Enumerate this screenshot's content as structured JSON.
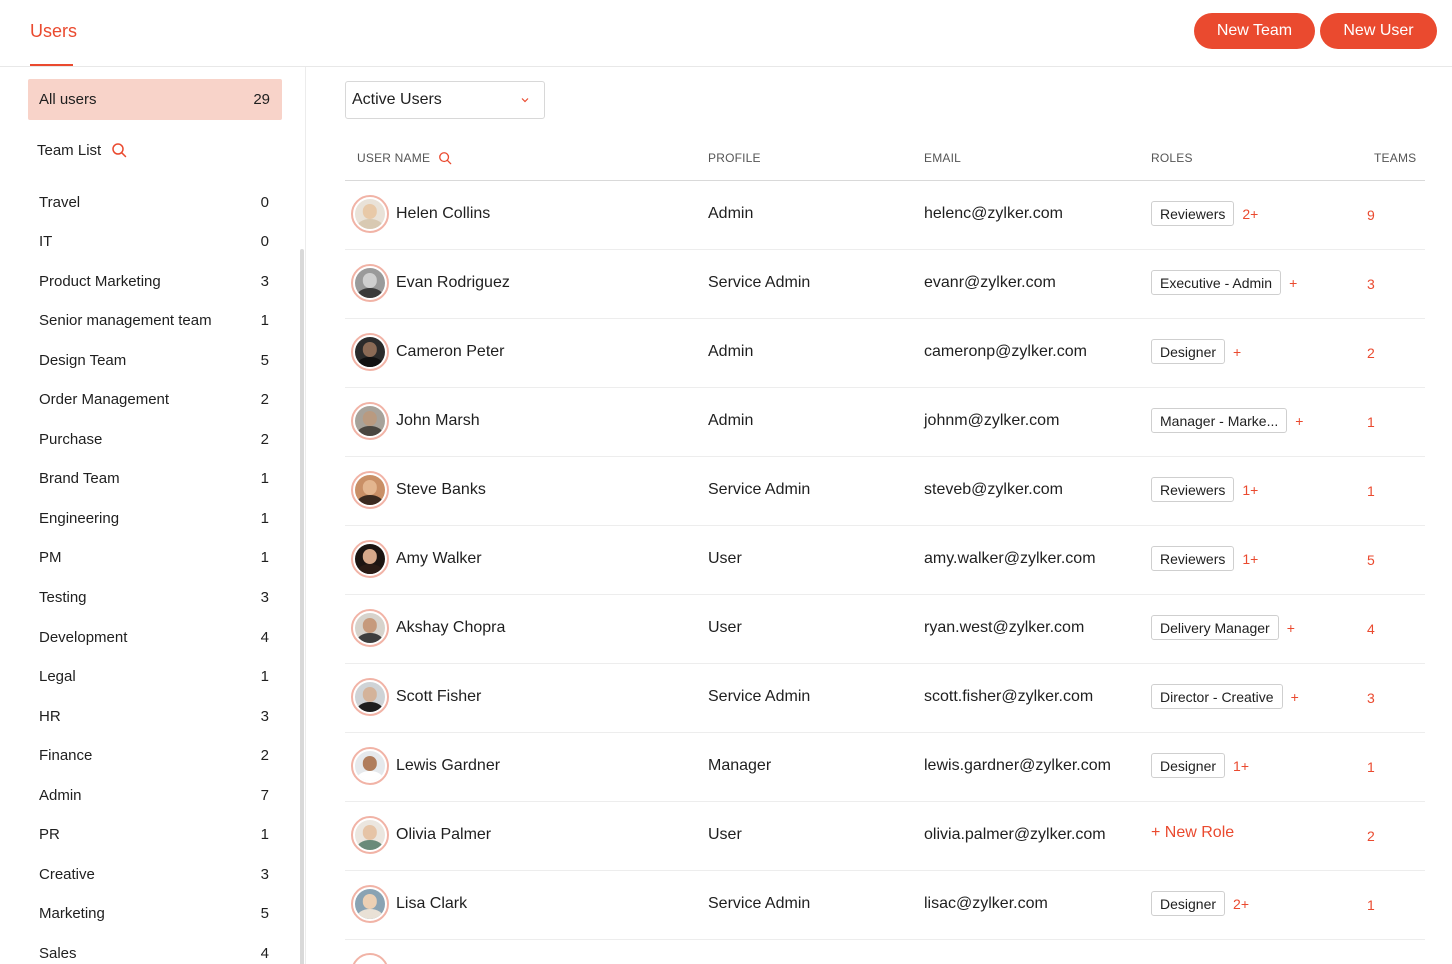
{
  "header": {
    "title": "Users",
    "new_team_label": "New Team",
    "new_user_label": "New User"
  },
  "colors": {
    "accent": "#ea4a2f",
    "selected_bg": "#f8d3c9",
    "avatar_ring": "#f1b3a6"
  },
  "sidebar": {
    "all_users_label": "All users",
    "all_users_count": "29",
    "team_list_label": "Team List",
    "teams": [
      {
        "name": "Travel",
        "count": "0"
      },
      {
        "name": "IT",
        "count": "0"
      },
      {
        "name": "Product Marketing",
        "count": "3"
      },
      {
        "name": "Senior management team",
        "count": "1"
      },
      {
        "name": "Design Team",
        "count": "5"
      },
      {
        "name": "Order Management",
        "count": "2"
      },
      {
        "name": "Purchase",
        "count": "2"
      },
      {
        "name": "Brand Team",
        "count": "1"
      },
      {
        "name": "Engineering",
        "count": "1"
      },
      {
        "name": "PM",
        "count": "1"
      },
      {
        "name": "Testing",
        "count": "3"
      },
      {
        "name": "Development",
        "count": "4"
      },
      {
        "name": "Legal",
        "count": "1"
      },
      {
        "name": "HR",
        "count": "3"
      },
      {
        "name": "Finance",
        "count": "2"
      },
      {
        "name": "Admin",
        "count": "7"
      },
      {
        "name": "PR",
        "count": "1"
      },
      {
        "name": "Creative",
        "count": "3"
      },
      {
        "name": "Marketing",
        "count": "5"
      },
      {
        "name": "Sales",
        "count": "4"
      }
    ]
  },
  "filter": {
    "selected": "Active Users"
  },
  "table": {
    "columns": {
      "user_name": "USER NAME",
      "profile": "PROFILE",
      "email": "EMAIL",
      "roles": "ROLES",
      "teams": "TEAMS"
    },
    "rows": [
      {
        "name": "Helen Collins",
        "profile": "Admin",
        "email": "helenc@zylker.com",
        "role": "Reviewers",
        "role_more": "2+",
        "teams": "9",
        "avatar": {
          "bg": "#e9e2d8",
          "skin": "#e8c9a8",
          "top": "#d8c9b2"
        }
      },
      {
        "name": "Evan Rodriguez",
        "profile": "Service Admin",
        "email": "evanr@zylker.com",
        "role": "Executive - Admin",
        "role_more": "+",
        "teams": "3",
        "avatar": {
          "bg": "#9a9a9a",
          "skin": "#cfcfcf",
          "top": "#3a3a3a"
        }
      },
      {
        "name": "Cameron Peter",
        "profile": "Admin",
        "email": "cameronp@zylker.com",
        "role": "Designer",
        "role_more": "+",
        "teams": "2",
        "avatar": {
          "bg": "#2b2b2b",
          "skin": "#8a6a55",
          "top": "#111111"
        }
      },
      {
        "name": "John Marsh",
        "profile": "Admin",
        "email": "johnm@zylker.com",
        "role": "Manager - Marke...",
        "role_more": "+",
        "teams": "1",
        "avatar": {
          "bg": "#a7a29a",
          "skin": "#b99a80",
          "top": "#4a4640"
        }
      },
      {
        "name": "Steve Banks",
        "profile": "Service Admin",
        "email": "steveb@zylker.com",
        "role": "Reviewers",
        "role_more": "1+",
        "teams": "1",
        "avatar": {
          "bg": "#c98f66",
          "skin": "#e3b58f",
          "top": "#3b2a20"
        }
      },
      {
        "name": "Amy Walker",
        "profile": "User",
        "email": "amy.walker@zylker.com",
        "role": "Reviewers",
        "role_more": "1+",
        "teams": "5",
        "avatar": {
          "bg": "#1d1512",
          "skin": "#d7a88a",
          "top": "#2a1b15"
        }
      },
      {
        "name": "Akshay Chopra",
        "profile": "User",
        "email": "ryan.west@zylker.com",
        "role": "Delivery Manager",
        "role_more": "+",
        "teams": "4",
        "avatar": {
          "bg": "#d7d3cc",
          "skin": "#c69a7c",
          "top": "#3d3d3d"
        }
      },
      {
        "name": "Scott Fisher",
        "profile": "Service Admin",
        "email": "scott.fisher@zylker.com",
        "role": "Director - Creative",
        "role_more": "+",
        "teams": "3",
        "avatar": {
          "bg": "#cfd3d6",
          "skin": "#d4b39a",
          "top": "#1e1e1e"
        }
      },
      {
        "name": "Lewis Gardner",
        "profile": "Manager",
        "email": "lewis.gardner@zylker.com",
        "role": "Designer",
        "role_more": "1+",
        "teams": "1",
        "avatar": {
          "bg": "#e6e9ec",
          "skin": "#b07d5c",
          "top": "#ffffff"
        }
      },
      {
        "name": "Olivia Palmer",
        "profile": "User",
        "email": "olivia.palmer@zylker.com",
        "role": "",
        "role_more": "",
        "new_role": "+ New Role",
        "teams": "2",
        "avatar": {
          "bg": "#ebe6df",
          "skin": "#e6c4a6",
          "top": "#6a8a7a"
        }
      },
      {
        "name": "Lisa Clark",
        "profile": "Service Admin",
        "email": "lisac@zylker.com",
        "role": "Designer",
        "role_more": "2+",
        "teams": "1",
        "avatar": {
          "bg": "#8aa3b3",
          "skin": "#ecd0b4",
          "top": "#e9e1d6"
        }
      }
    ]
  }
}
